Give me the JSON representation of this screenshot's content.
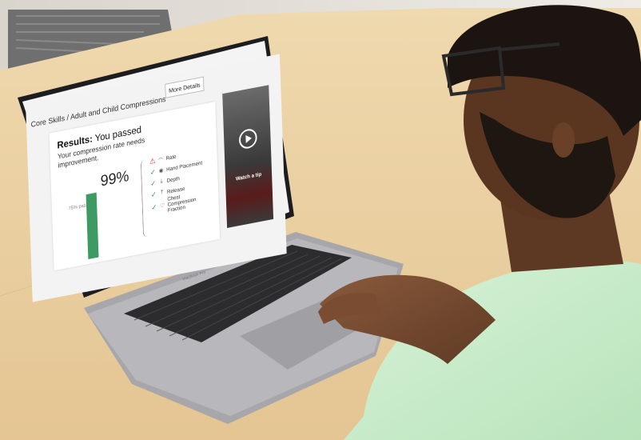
{
  "screen": {
    "breadcrumb": "Core Skills / Adult and Child Compressions",
    "more_details_label": "More Details",
    "results_heading": "Results:",
    "results_status": "You passed",
    "results_subtitle": "Your compression rate needs improvement.",
    "score_percent": "99%",
    "score_value": 0.99,
    "pass_threshold_label": "75% pass",
    "metrics": [
      {
        "label": "Rate",
        "status": "warning",
        "icon": "rate-gauge-icon"
      },
      {
        "label": "Hand Placement",
        "status": "ok",
        "icon": "hand-placement-icon"
      },
      {
        "label": "Depth",
        "status": "ok",
        "icon": "depth-icon"
      },
      {
        "label": "Release",
        "status": "ok",
        "icon": "release-icon"
      },
      {
        "label": "Chest Compression Fraction",
        "status": "ok",
        "icon": "heart-icon"
      }
    ],
    "video_label": "Watch a tip"
  },
  "laptop": {
    "brand_label": "MacBook Pro"
  },
  "colors": {
    "pass_green": "#3e9a63",
    "warning_red": "#d22222",
    "shirt_mint": "#c8eccb",
    "desk_wood": "#e9cf9f"
  }
}
